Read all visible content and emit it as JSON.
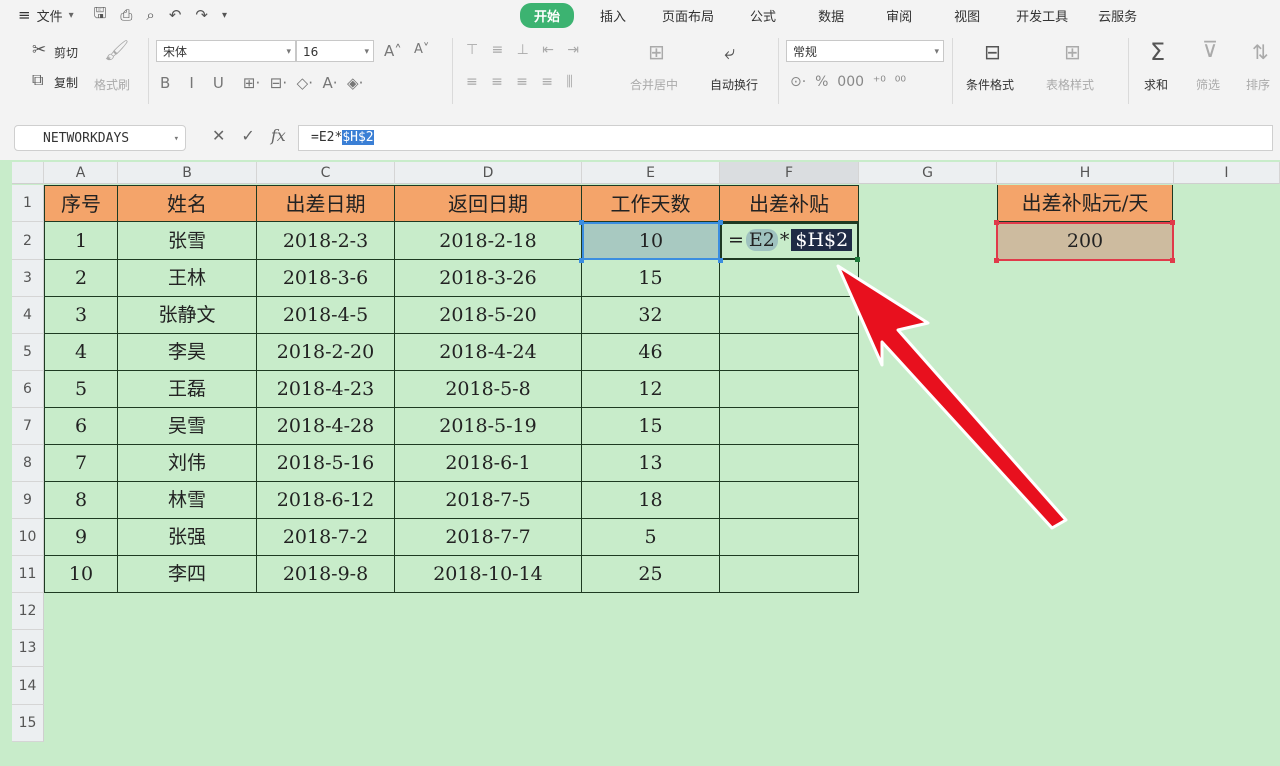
{
  "titlebar": {
    "file_label": "文件",
    "tabs": [
      "开始",
      "插入",
      "页面布局",
      "公式",
      "数据",
      "审阅",
      "视图",
      "开发工具",
      "云服务"
    ],
    "active_tab": "开始"
  },
  "ribbon": {
    "cut": "剪切",
    "copy": "复制",
    "format_painter": "格式刷",
    "font_name": "宋体",
    "font_size": "16",
    "merge_center": "合并居中",
    "wrap_text": "自动换行",
    "number_format": "常规",
    "conditional_format": "条件格式",
    "table_style": "表格样式",
    "sum": "求和",
    "filter": "筛选",
    "sort": "排序"
  },
  "formula_bar": {
    "name_box": "NETWORKDAYS",
    "fx": "fx",
    "formula_prefix": "=E2*",
    "formula_selected": "$H$2"
  },
  "sheet": {
    "columns": [
      "A",
      "B",
      "C",
      "D",
      "E",
      "F",
      "G",
      "H",
      "I"
    ],
    "rows": [
      "1",
      "2",
      "3",
      "4",
      "5",
      "6",
      "7",
      "8",
      "9",
      "10",
      "11",
      "12",
      "13",
      "14",
      "15"
    ],
    "headers": [
      "序号",
      "姓名",
      "出差日期",
      "返回日期",
      "工作天数",
      "出差补贴"
    ],
    "data": [
      [
        "1",
        "张雪",
        "2018-2-3",
        "2018-2-18",
        "10"
      ],
      [
        "2",
        "王林",
        "2018-3-6",
        "2018-3-26",
        "15"
      ],
      [
        "3",
        "张静文",
        "2018-4-5",
        "2018-5-20",
        "32"
      ],
      [
        "4",
        "李昊",
        "2018-2-20",
        "2018-4-24",
        "46"
      ],
      [
        "5",
        "王磊",
        "2018-4-23",
        "2018-5-8",
        "12"
      ],
      [
        "6",
        "吴雪",
        "2018-4-28",
        "2018-5-19",
        "15"
      ],
      [
        "7",
        "刘伟",
        "2018-5-16",
        "2018-6-1",
        "13"
      ],
      [
        "8",
        "林雪",
        "2018-6-12",
        "2018-7-5",
        "18"
      ],
      [
        "9",
        "张强",
        "2018-7-2",
        "2018-7-7",
        "5"
      ],
      [
        "10",
        "李四",
        "2018-9-8",
        "2018-10-14",
        "25"
      ]
    ],
    "f2_formula": {
      "eq": "=",
      "ref1": "E2",
      "op": "*",
      "ref2": "$H$2"
    },
    "h1": "出差补贴元/天",
    "h2": "200"
  },
  "colors": {
    "header_fill": "#f4a46a",
    "sheet_bg": "#c8ecca",
    "active_tab": "#3cb371",
    "arrow": "#e8101e"
  }
}
